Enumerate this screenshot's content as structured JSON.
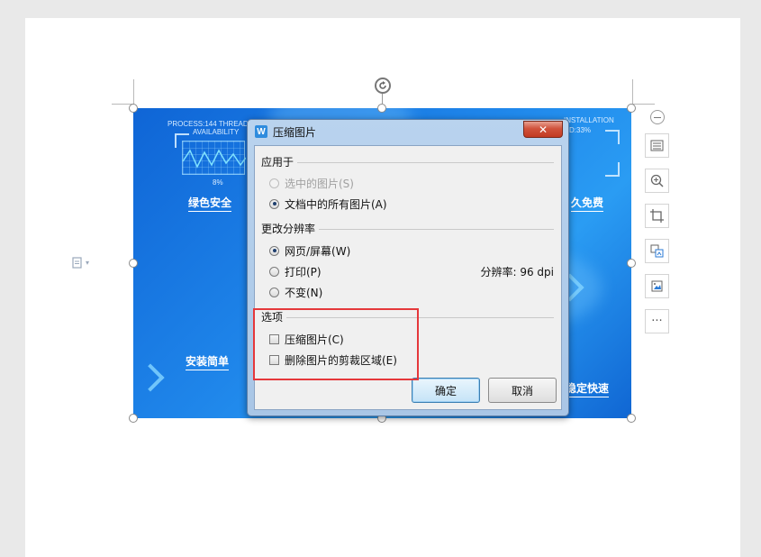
{
  "dialog": {
    "title": "压缩图片",
    "close_label": "✕",
    "app_icon_letter": "W",
    "apply_to": {
      "heading": "应用于",
      "selected_images": "选中的图片(S)",
      "all_images": "文档中的所有图片(A)"
    },
    "resolution": {
      "heading": "更改分辨率",
      "web_screen": "网页/屏幕(W)",
      "print": "打印(P)",
      "no_change": "不变(N)",
      "resolution_info": "分辨率: 96 dpi"
    },
    "options": {
      "heading": "选项",
      "compress_images": "压缩图片(C)",
      "delete_cropped": "删除图片的剪裁区域(E)"
    },
    "buttons": {
      "ok": "确定",
      "cancel": "取消"
    }
  },
  "image": {
    "hud_left_top": "PROCESS:144  THREAD",
    "hud_left_sub": "AVAILABILITY",
    "hud_left_pct": "8%",
    "hud_right_top": "INSTALLATION",
    "hud_right_sub": "D:33%",
    "feature_green_security": "绿色安全",
    "feature_free": "久免费",
    "feature_easy_install": "安装简单",
    "feature_stable_fast": "稳定快速"
  },
  "side_toolbar": {
    "icons": [
      "collapse-icon",
      "wrap-text-icon",
      "zoom-in-icon",
      "crop-icon",
      "replace-image-icon",
      "image-settings-icon",
      "more-icon"
    ],
    "more_label": "···"
  },
  "colors": {
    "highlight_border": "#e5383b",
    "dialog_frame": "#b9d3ee",
    "image_blue": "#1f86ea"
  }
}
